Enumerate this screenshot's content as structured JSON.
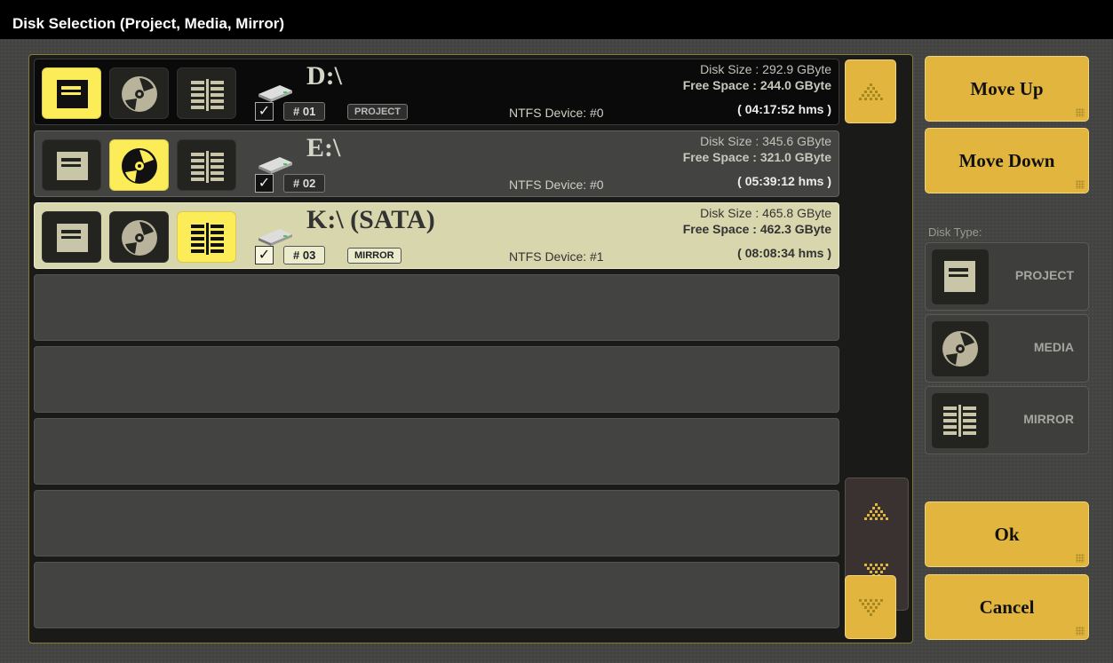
{
  "window": {
    "title": "Disk Selection (Project, Media, Mirror)"
  },
  "disks": [
    {
      "name": "D:\\",
      "checked": "✓",
      "number": "# 01",
      "type": "PROJECT",
      "ntfs": "NTFS Device: #0",
      "disk_size": "Disk Size : 292.9 GByte",
      "free_space": "Free Space : 244.0 GByte",
      "duration": "( 04:17:52 hms )",
      "active_type": "project",
      "selected": false
    },
    {
      "name": "E:\\",
      "checked": "✓",
      "number": "# 02",
      "type": "",
      "ntfs": "NTFS Device: #0",
      "disk_size": "Disk Size : 345.6 GByte",
      "free_space": "Free Space : 321.0 GByte",
      "duration": "( 05:39:12 hms )",
      "active_type": "media",
      "selected": false
    },
    {
      "name": "K:\\ (SATA)",
      "checked": "✓",
      "number": "# 03",
      "type": "MIRROR",
      "ntfs": "NTFS Device: #1",
      "disk_size": "Disk Size : 465.8 GByte",
      "free_space": "Free Space : 462.3 GByte",
      "duration": "( 08:08:34 hms )",
      "active_type": "mirror",
      "selected": true
    }
  ],
  "buttons": {
    "move_up": "Move Up",
    "move_down": "Move Down",
    "ok": "Ok",
    "cancel": "Cancel"
  },
  "disk_type": {
    "label": "Disk Type:",
    "options": [
      "PROJECT",
      "MEDIA",
      "MIRROR"
    ]
  },
  "colors": {
    "accent": "#e2b53f",
    "active_icon": "#fbec58",
    "selected_row": "#d8d6ac",
    "titlebar": "#000000"
  }
}
